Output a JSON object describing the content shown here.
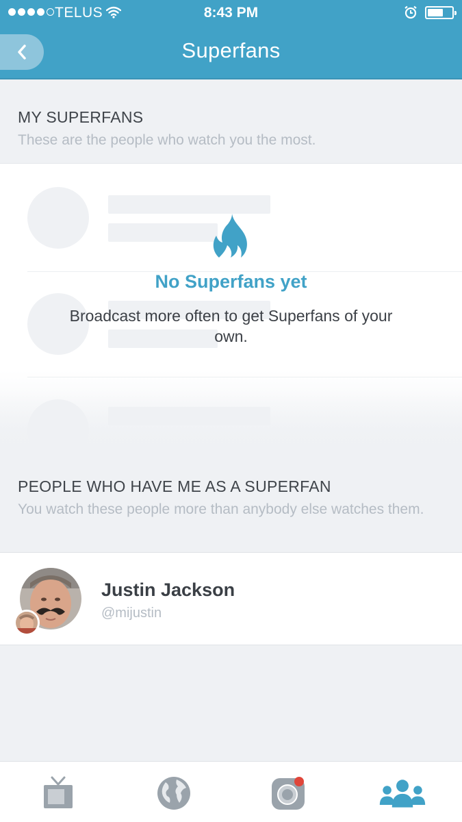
{
  "status_bar": {
    "carrier": "TELUS",
    "time": "8:43 PM"
  },
  "nav": {
    "title": "Superfans"
  },
  "my_superfans": {
    "title": "MY SUPERFANS",
    "subtitle": "These are the people who watch you the most.",
    "empty_title": "No Superfans yet",
    "empty_body": "Broadcast more often to get Superfans of your own."
  },
  "superfan_of": {
    "title": "PEOPLE WHO HAVE ME AS A SUPERFAN",
    "subtitle": "You watch these people more than anybody else watches them.",
    "people": [
      {
        "name": "Justin Jackson",
        "handle": "@mijustin"
      }
    ]
  },
  "colors": {
    "accent": "#41a2c7",
    "background": "#eff1f4",
    "notification_dot": "#e0463a"
  },
  "tabs": [
    {
      "icon": "tv-icon",
      "active": false
    },
    {
      "icon": "globe-icon",
      "active": false
    },
    {
      "icon": "broadcast-camera-icon",
      "active": false
    },
    {
      "icon": "people-icon",
      "active": true
    }
  ]
}
